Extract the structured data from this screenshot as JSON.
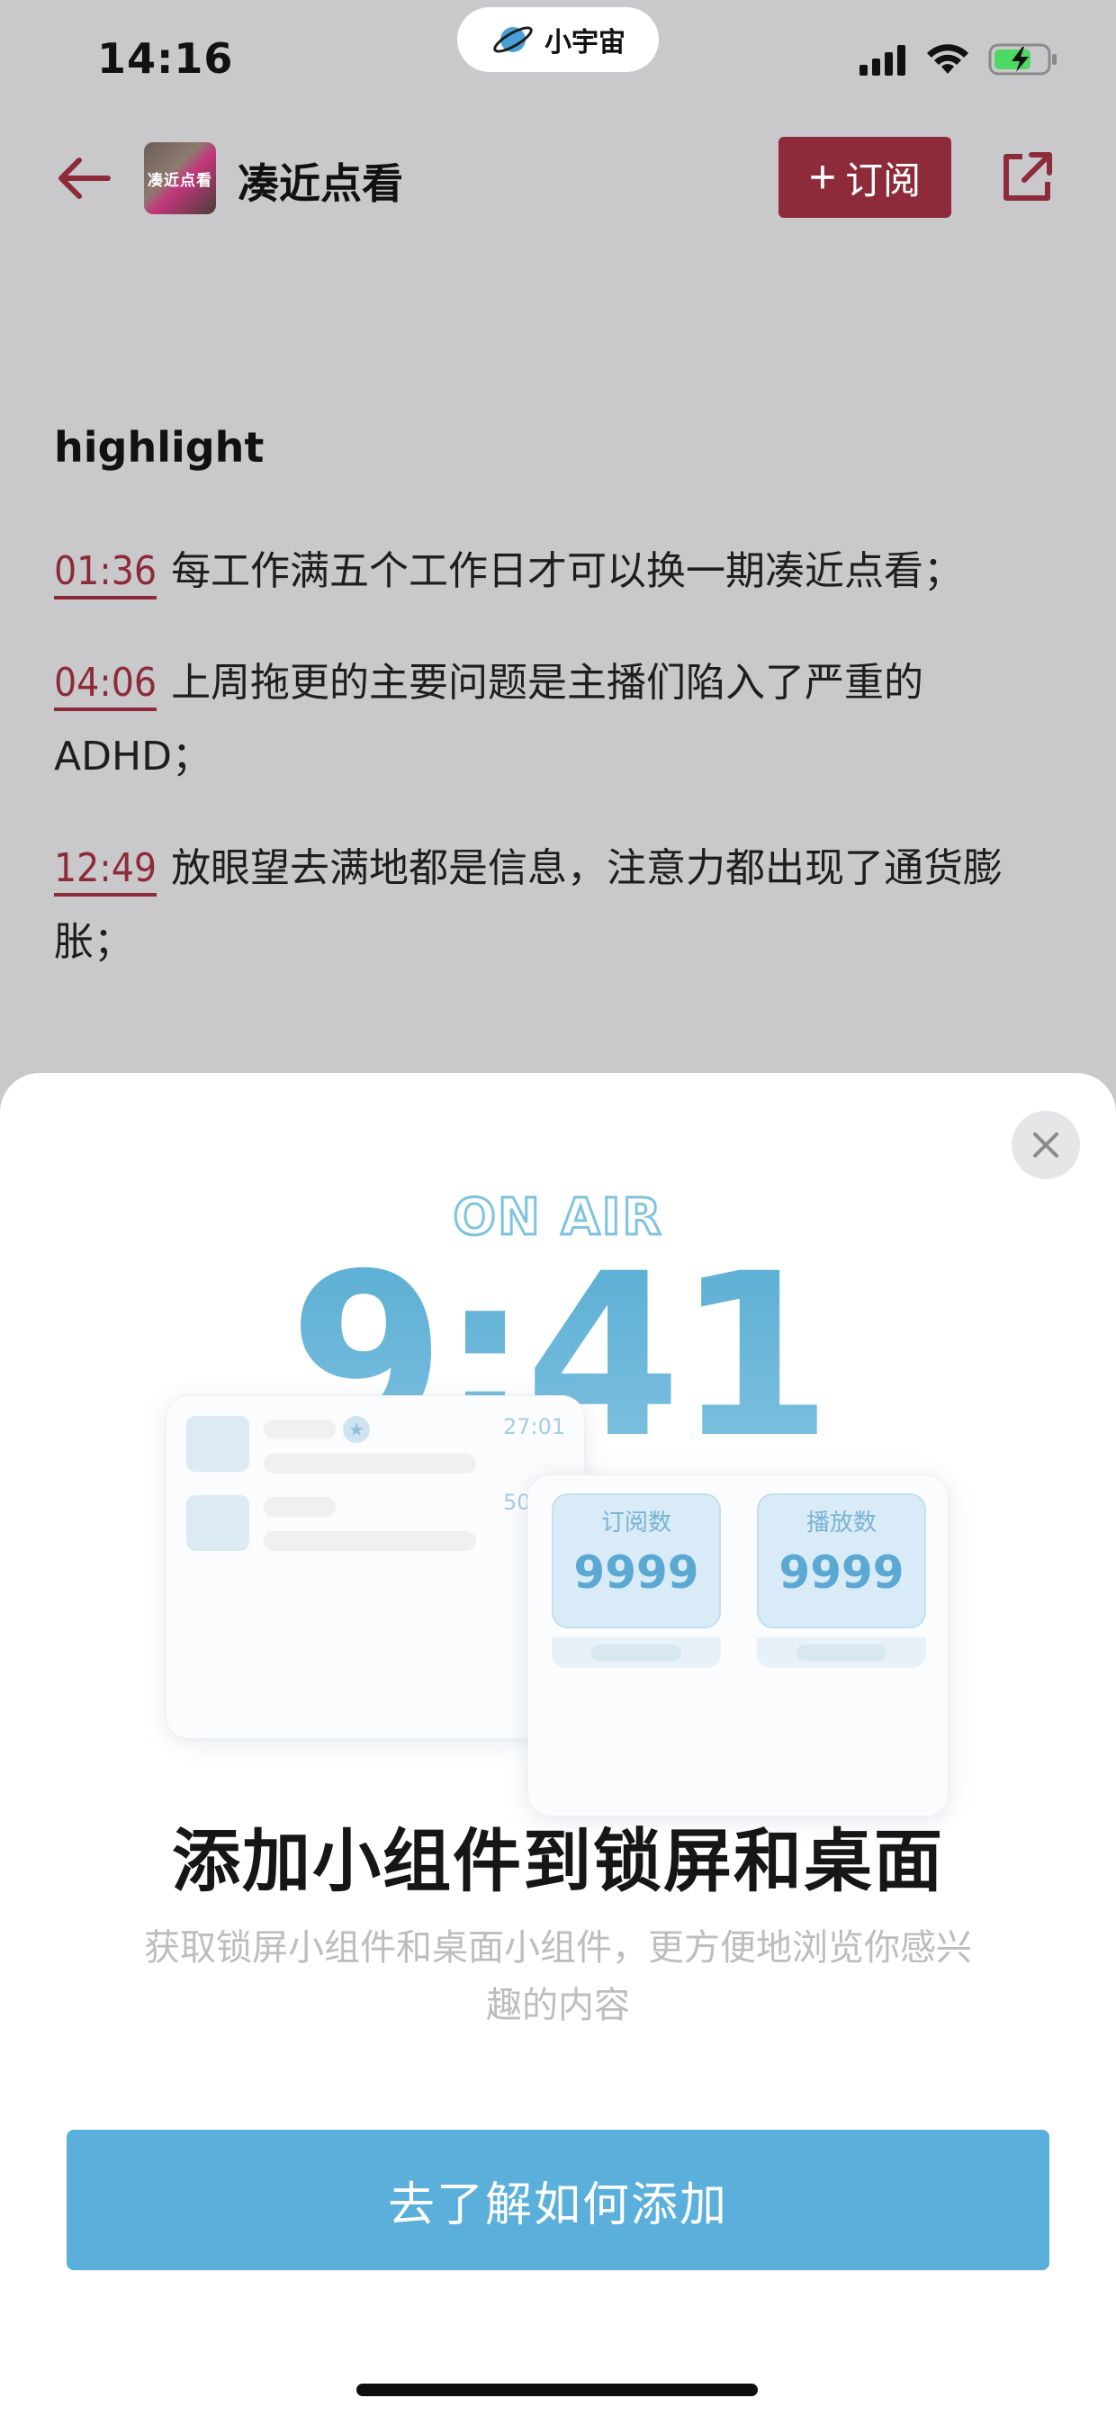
{
  "status_bar": {
    "time": "14:16",
    "app_pill_label": "小宇宙"
  },
  "nav": {
    "podcast_title": "凑近点看",
    "cover_text": "凑近点看",
    "subscribe_label": "订阅"
  },
  "content": {
    "heading": "highlight",
    "highlights": [
      {
        "time": "01:36",
        "text": "每工作满五个工作日才可以换一期凑近点看；"
      },
      {
        "time": "04:06",
        "text": "上周拖更的主要问题是主播们陷入了严重的ADHD；"
      },
      {
        "time": "12:49",
        "text": "放眼望去满地都是信息，注意力都出现了通货膨胀；"
      }
    ]
  },
  "sheet": {
    "illustration": {
      "on_air": "ON AIR",
      "clock": "9:41",
      "mini_time_1": "27:01",
      "mini_time_2": "50",
      "stats": [
        {
          "label": "订阅数",
          "value": "9999"
        },
        {
          "label": "播放数",
          "value": "9999"
        }
      ]
    },
    "title": "添加小组件到锁屏和桌面",
    "description": "获取锁屏小组件和桌面小组件，更方便地浏览你感兴趣的内容",
    "cta_label": "去了解如何添加"
  },
  "colors": {
    "accent": "#8e2b3a",
    "cta": "#5aafdb",
    "dim_background": "#c9c9cb"
  },
  "icons": [
    "planet-icon",
    "cellular-signal-icon",
    "wifi-icon",
    "battery-charging-icon",
    "back-arrow-icon",
    "plus-icon",
    "share-icon",
    "close-icon",
    "star-icon"
  ]
}
